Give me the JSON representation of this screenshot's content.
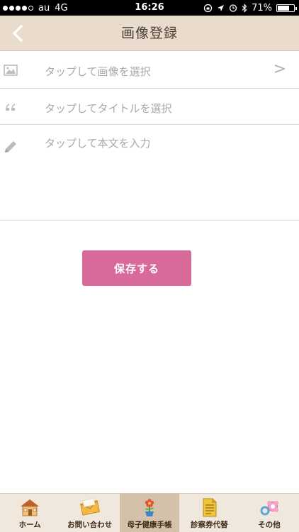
{
  "status_bar": {
    "carrier": "au",
    "network": "4G",
    "time": "16:26",
    "battery": "71%",
    "battery_level": 0.71
  },
  "nav": {
    "title": "画像登録"
  },
  "form": {
    "image_placeholder": "タップして画像を選択",
    "title_placeholder": "タップしてタイトルを選択",
    "body_placeholder": "タップして本文を入力",
    "chevron": ">"
  },
  "save_button": {
    "label": "保存する",
    "color": "#d86a9b"
  },
  "tabs": [
    {
      "label": "ホーム",
      "icon": "house-icon"
    },
    {
      "label": "お問い合わせ",
      "icon": "envelope-icon"
    },
    {
      "label": "母子健康手帳",
      "icon": "flower-pot-icon",
      "active": true
    },
    {
      "label": "診察券代替",
      "icon": "document-icon"
    },
    {
      "label": "その他",
      "icon": "flower-ring-icon"
    }
  ],
  "colors": {
    "nav_background": "#e9dccc",
    "tab_background": "#f1e8dd",
    "tab_active": "#d4c1aa"
  }
}
